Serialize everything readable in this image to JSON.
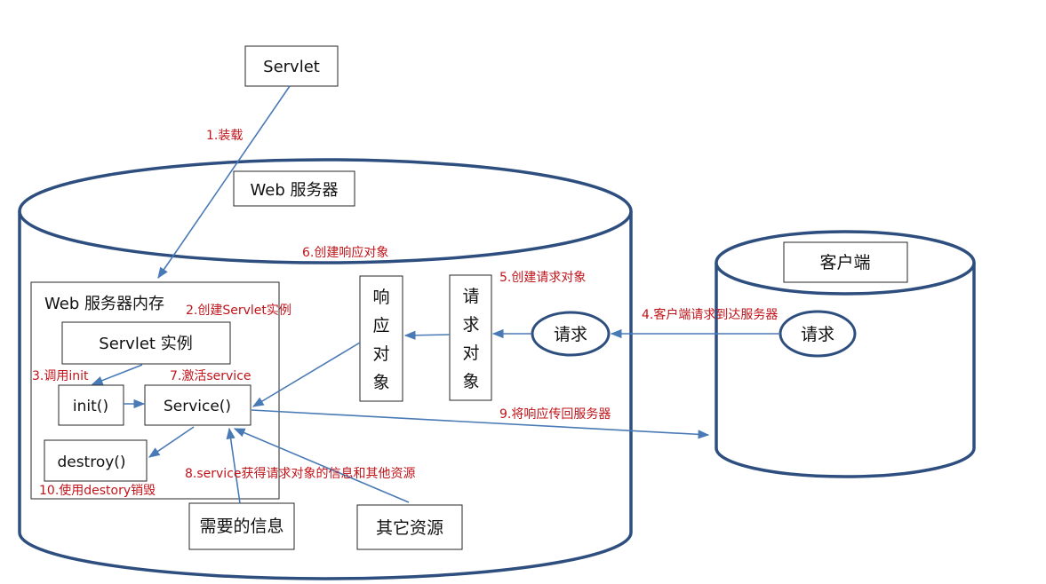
{
  "nodes": {
    "servlet": "Servlet",
    "web_server": "Web 服务器",
    "web_memory": "Web 服务器内存",
    "servlet_instance": "Servlet 实例",
    "init": "init()",
    "service": "Service()",
    "destroy": "destroy()",
    "needed_info": "需要的信息",
    "other_resources": "其它资源",
    "response_object": [
      "响",
      "应",
      "对",
      "象"
    ],
    "request_object": [
      "请",
      "求",
      "对",
      "象"
    ],
    "request_server": "请求",
    "client": "客户端",
    "request_client": "请求"
  },
  "steps": {
    "s1": "1.装载",
    "s2": "2.创建Servlet实例",
    "s3": "3.调用init",
    "s4": "4.客户端请求到达服务器",
    "s5": "5.创建请求对象",
    "s6": "6.创建响应对象",
    "s7": "7.激活service",
    "s8": "8.service获得请求对象的信息和其他资源",
    "s9": "9.将响应传回服务器",
    "s10": "10.使用destory销毁"
  },
  "colors": {
    "cylinder_stroke": "#2d4e7e",
    "arrow": "#4a7ab6",
    "step_label": "#c0141a"
  }
}
